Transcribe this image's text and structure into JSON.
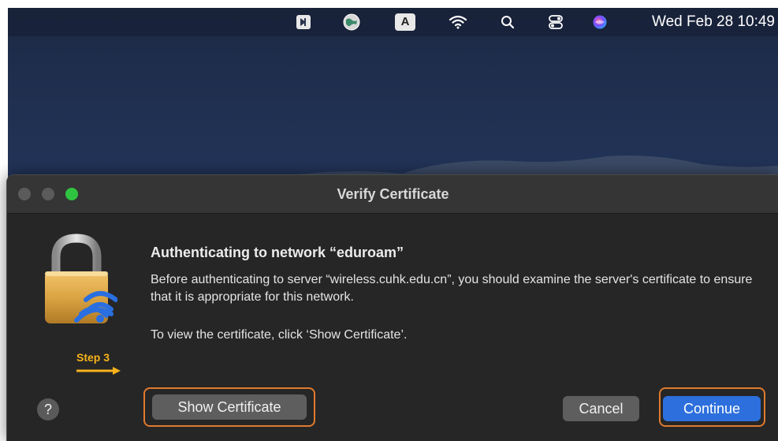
{
  "menubar": {
    "icons": [
      "tray-app-icon",
      "vpn-globe-icon",
      "input-source-icon",
      "wifi-icon",
      "spotlight-search-icon",
      "control-center-icon",
      "siri-icon"
    ],
    "input_source_letter": "A",
    "clock": "Wed Feb 28  10:49"
  },
  "dialog": {
    "title": "Verify Certificate",
    "heading": "Authenticating to network “eduroam”",
    "body": "Before authenticating to server “wireless.cuhk.edu.cn”, you should examine the server's certificate to ensure that it is appropriate for this network.",
    "body2": "To view the certificate, click ‘Show Certificate’.",
    "help_label": "?",
    "show_certificate_label": "Show Certificate",
    "cancel_label": "Cancel",
    "continue_label": "Continue"
  },
  "annotation": {
    "step_label": "Step 3",
    "color": "#e07a2e",
    "step_color": "#f7b21a"
  },
  "colors": {
    "accent": "#2d6fdc",
    "window_bg": "#262626",
    "titlebar_bg": "#353535",
    "traffic_max": "#2fc440"
  }
}
